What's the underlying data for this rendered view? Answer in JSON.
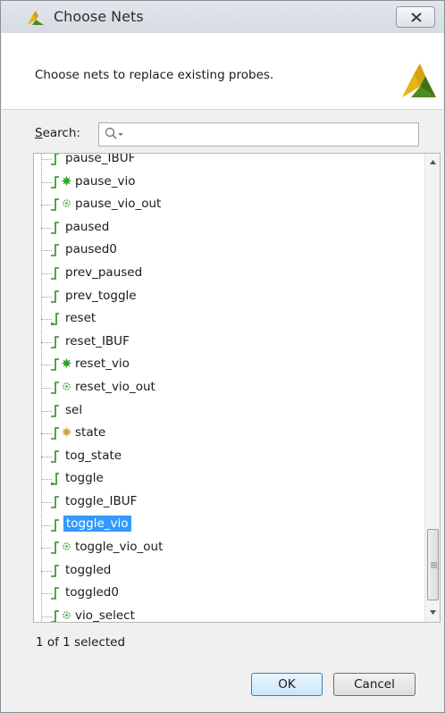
{
  "window": {
    "title": "Choose Nets",
    "close_icon": "close-icon"
  },
  "header": {
    "description": "Choose nets to replace existing probes."
  },
  "search": {
    "label_accel": "S",
    "label_rest": "earch:",
    "value": "",
    "icon": "search-icon"
  },
  "nets": [
    {
      "label": "pause_IBUF",
      "icon": "net-icon",
      "badge": ""
    },
    {
      "label": "pause_vio",
      "icon": "net-icon",
      "badge": "debug-probe-icon"
    },
    {
      "label": "pause_vio_out",
      "icon": "net-icon",
      "badge": "gear-icon"
    },
    {
      "label": "paused",
      "icon": "net-icon",
      "badge": ""
    },
    {
      "label": "paused0",
      "icon": "net-icon",
      "badge": ""
    },
    {
      "label": "prev_paused",
      "icon": "net-icon",
      "badge": ""
    },
    {
      "label": "prev_toggle",
      "icon": "net-icon",
      "badge": ""
    },
    {
      "label": "reset",
      "icon": "port-net-icon",
      "badge": ""
    },
    {
      "label": "reset_IBUF",
      "icon": "net-icon",
      "badge": ""
    },
    {
      "label": "reset_vio",
      "icon": "net-icon",
      "badge": "debug-probe-icon"
    },
    {
      "label": "reset_vio_out",
      "icon": "net-icon",
      "badge": "gear-icon"
    },
    {
      "label": "sel",
      "icon": "net-icon",
      "badge": ""
    },
    {
      "label": "state",
      "icon": "net-icon",
      "badge": "marked-icon"
    },
    {
      "label": "tog_state",
      "icon": "net-icon",
      "badge": ""
    },
    {
      "label": "toggle",
      "icon": "port-net-icon",
      "badge": ""
    },
    {
      "label": "toggle_IBUF",
      "icon": "net-icon",
      "badge": ""
    },
    {
      "label": "toggle_vio",
      "icon": "net-icon",
      "badge": "",
      "selected": true
    },
    {
      "label": "toggle_vio_out",
      "icon": "net-icon",
      "badge": "gear-icon"
    },
    {
      "label": "toggled",
      "icon": "net-icon",
      "badge": ""
    },
    {
      "label": "toggled0",
      "icon": "net-icon",
      "badge": ""
    },
    {
      "label": "vio_select",
      "icon": "net-icon",
      "badge": "gear-icon"
    }
  ],
  "status": "1 of 1 selected",
  "buttons": {
    "ok": "OK",
    "cancel": "Cancel"
  },
  "colors": {
    "selection": "#3399ff",
    "net_icon": "#2e8b22",
    "debug_badge": "#2aa52a",
    "gear_badge": "#5ba35b",
    "marked_badge": "#c8a83c",
    "logo_yellow": "#e7b416",
    "logo_green": "#4f8a1f"
  }
}
